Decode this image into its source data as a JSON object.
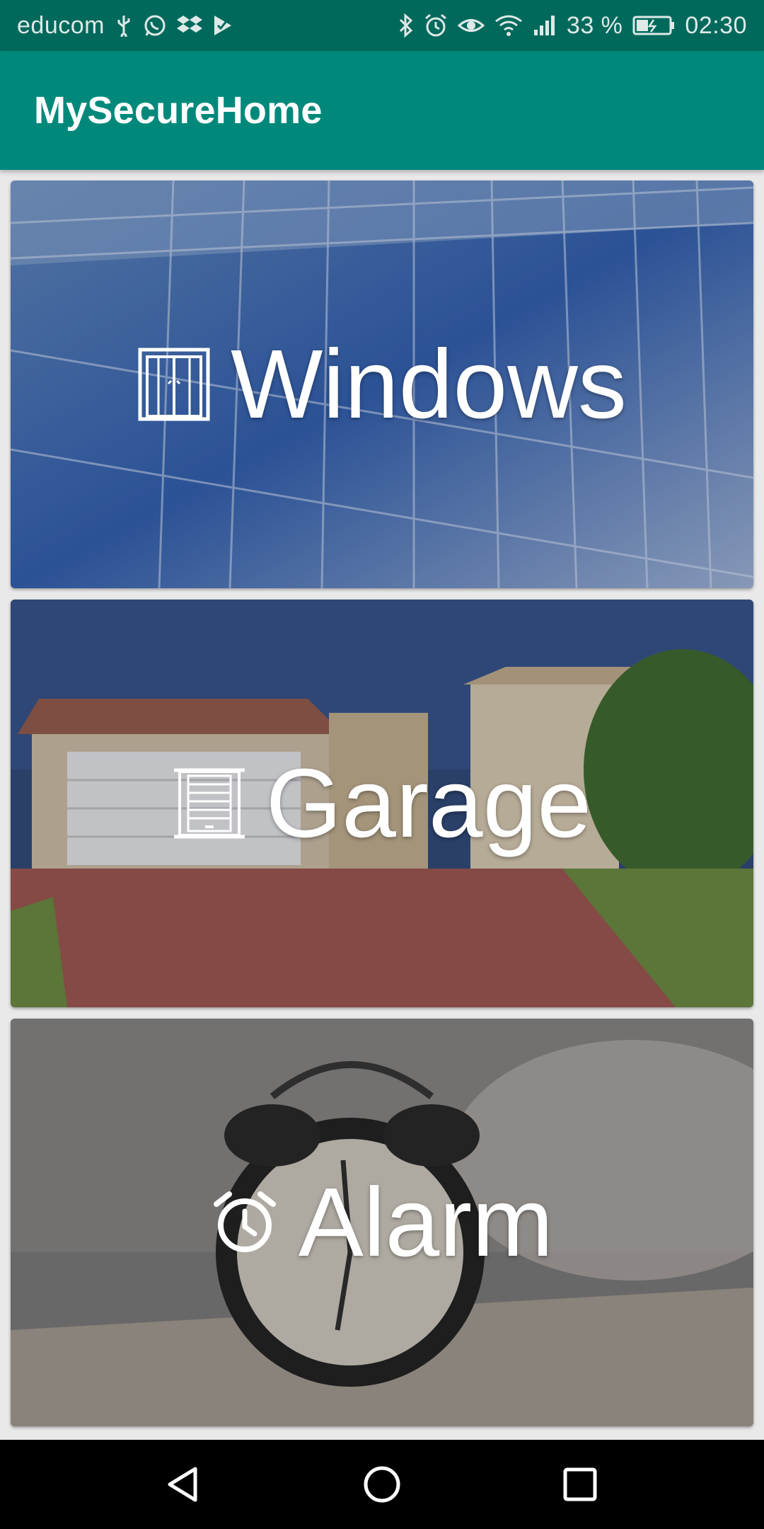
{
  "status_bar": {
    "carrier": "educom",
    "battery_percent": "33 %",
    "time": "02:30",
    "icons_left": [
      "usb-icon",
      "whatsapp-icon",
      "dropbox-icon",
      "task-icon"
    ],
    "icons_right": [
      "bluetooth-icon",
      "alarm-icon",
      "eye-icon",
      "wifi-icon",
      "signal-icon",
      "battery-icon"
    ]
  },
  "app_bar": {
    "title": "MySecureHome",
    "color": "#00897b",
    "status_color": "#00695c"
  },
  "cards": [
    {
      "label": "Windows",
      "icon": "window-icon"
    },
    {
      "label": "Garage",
      "icon": "garage-door-icon"
    },
    {
      "label": "Alarm",
      "icon": "alarm-clock-icon"
    }
  ],
  "nav_bar": {
    "buttons": [
      "back-icon",
      "home-icon",
      "recents-icon"
    ]
  }
}
